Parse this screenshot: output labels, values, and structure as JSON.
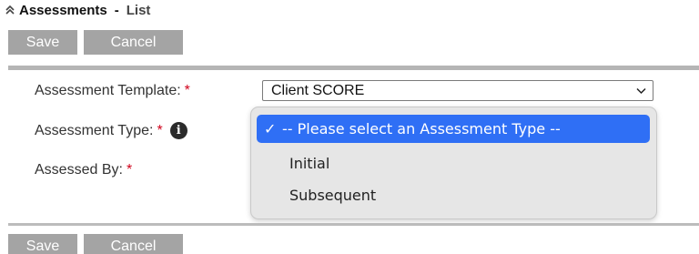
{
  "header": {
    "title": "Assessments",
    "separator": "-",
    "subtitle": "List"
  },
  "toolbar_top": {
    "save_label": "Save",
    "cancel_label": "Cancel"
  },
  "toolbar_bottom": {
    "save_label": "Save",
    "cancel_label": "Cancel"
  },
  "form": {
    "template_label": "Assessment Template:",
    "type_label": "Assessment Type:",
    "assessed_by_label": "Assessed By:",
    "required_marker": "*",
    "info_glyph": "i",
    "template_value": "Client SCORE"
  },
  "dropdown": {
    "check_glyph": "✓",
    "options": [
      {
        "label": "-- Please select an Assessment Type --",
        "selected": true
      },
      {
        "label": "Initial",
        "selected": false
      },
      {
        "label": "Subsequent",
        "selected": false
      }
    ]
  },
  "colors": {
    "button_bg": "#a4a4a4",
    "required": "#d0021b",
    "selection": "#2f6ff5",
    "popup_bg": "#e6e6e6"
  },
  "icons": {
    "collapse": "collapse-up-icon",
    "info": "info-icon",
    "chevron": "chevron-down-icon",
    "check": "checkmark-icon"
  }
}
